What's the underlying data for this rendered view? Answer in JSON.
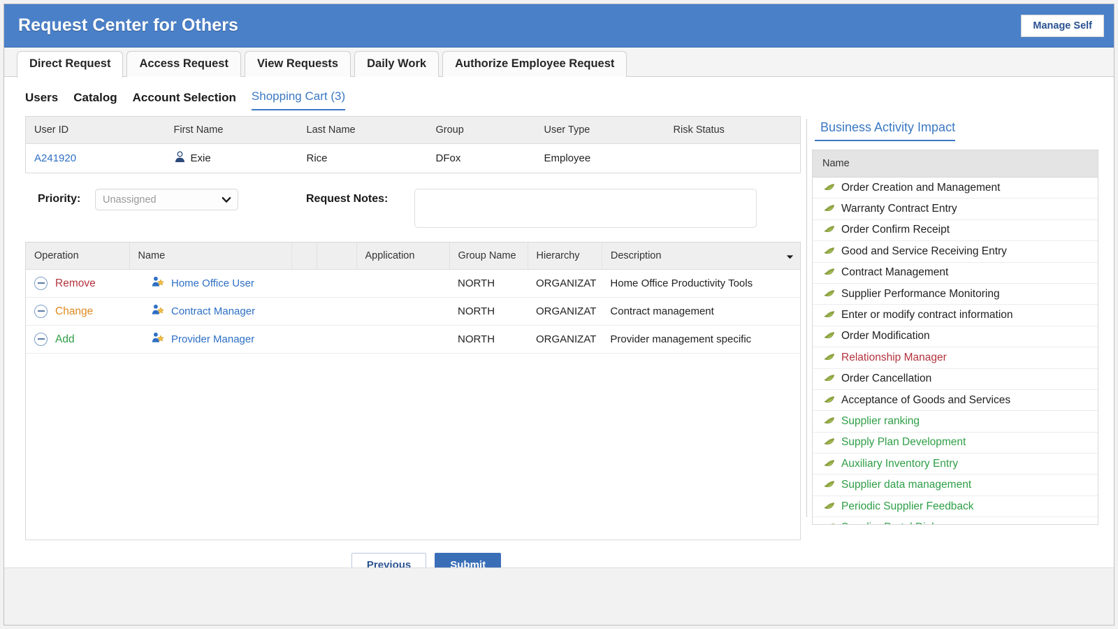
{
  "header": {
    "title": "Request Center for Others",
    "manage_self_label": "Manage Self",
    "accent_color": "#4a80c8"
  },
  "tabs": [
    {
      "label": "Direct Request",
      "active": true
    },
    {
      "label": "Access Request",
      "active": false
    },
    {
      "label": "View Requests",
      "active": false
    },
    {
      "label": "Daily Work",
      "active": false
    },
    {
      "label": "Authorize Employee Request",
      "active": false
    }
  ],
  "subnav": [
    {
      "label": "Users",
      "active": false
    },
    {
      "label": "Catalog",
      "active": false
    },
    {
      "label": "Account Selection",
      "active": false
    },
    {
      "label": "Shopping Cart (3)",
      "active": true
    }
  ],
  "user_table": {
    "columns": [
      "User ID",
      "First Name",
      "Last Name",
      "Group",
      "User Type",
      "Risk Status"
    ],
    "rows": [
      {
        "user_id": "A241920",
        "first_name": "Exie",
        "last_name": "Rice",
        "group": "DFox",
        "user_type": "Employee",
        "risk_status": ""
      }
    ]
  },
  "form": {
    "priority_label": "Priority:",
    "priority_value": "Unassigned",
    "notes_label": "Request Notes:",
    "notes_value": "",
    "notes_placeholder": ""
  },
  "ops_table": {
    "columns": [
      "Operation",
      "Name",
      "",
      "",
      "Application",
      "Group Name",
      "Hierarchy",
      "Description"
    ],
    "rows": [
      {
        "operation": "Remove",
        "operation_kind": "remove",
        "name": "Home Office User",
        "application": "",
        "group_name": "NORTH",
        "hierarchy": "ORGANIZAT",
        "description": "Home Office Productivity Tools"
      },
      {
        "operation": "Change",
        "operation_kind": "change",
        "name": "Contract Manager",
        "application": "",
        "group_name": "NORTH",
        "hierarchy": "ORGANIZAT",
        "description": "Contract management"
      },
      {
        "operation": "Add",
        "operation_kind": "add",
        "name": "Provider Manager",
        "application": "",
        "group_name": "NORTH",
        "hierarchy": "ORGANIZAT",
        "description": "Provider management specific"
      }
    ]
  },
  "business_activity_impact": {
    "title": "Business Activity Impact",
    "column_header": "Name",
    "items": [
      {
        "label": "Order Creation and Management",
        "state": "neutral"
      },
      {
        "label": "Warranty Contract Entry",
        "state": "neutral"
      },
      {
        "label": "Order Confirm Receipt",
        "state": "neutral"
      },
      {
        "label": "Good and Service Receiving Entry",
        "state": "neutral"
      },
      {
        "label": "Contract Management",
        "state": "neutral"
      },
      {
        "label": "Supplier Performance Monitoring",
        "state": "neutral"
      },
      {
        "label": "Enter or modify contract information",
        "state": "neutral"
      },
      {
        "label": "Order Modification",
        "state": "neutral"
      },
      {
        "label": "Relationship Manager",
        "state": "removed"
      },
      {
        "label": "Order Cancellation",
        "state": "neutral"
      },
      {
        "label": "Acceptance of Goods and Services",
        "state": "neutral"
      },
      {
        "label": "Supplier ranking",
        "state": "added"
      },
      {
        "label": "Supply Plan Development",
        "state": "added"
      },
      {
        "label": "Auxiliary Inventory Entry",
        "state": "added"
      },
      {
        "label": "Supplier data management",
        "state": "added"
      },
      {
        "label": "Periodic Supplier Feedback",
        "state": "added"
      },
      {
        "label": "Supplier Portal Dialogue",
        "state": "added"
      }
    ]
  },
  "footer": {
    "previous_label": "Previous",
    "submit_label": "Submit"
  },
  "colors": {
    "remove": "#b3333c",
    "change": "#e08a20",
    "add": "#2e9e46",
    "link": "#2d6fc4",
    "submit": "#3a6fb8"
  }
}
